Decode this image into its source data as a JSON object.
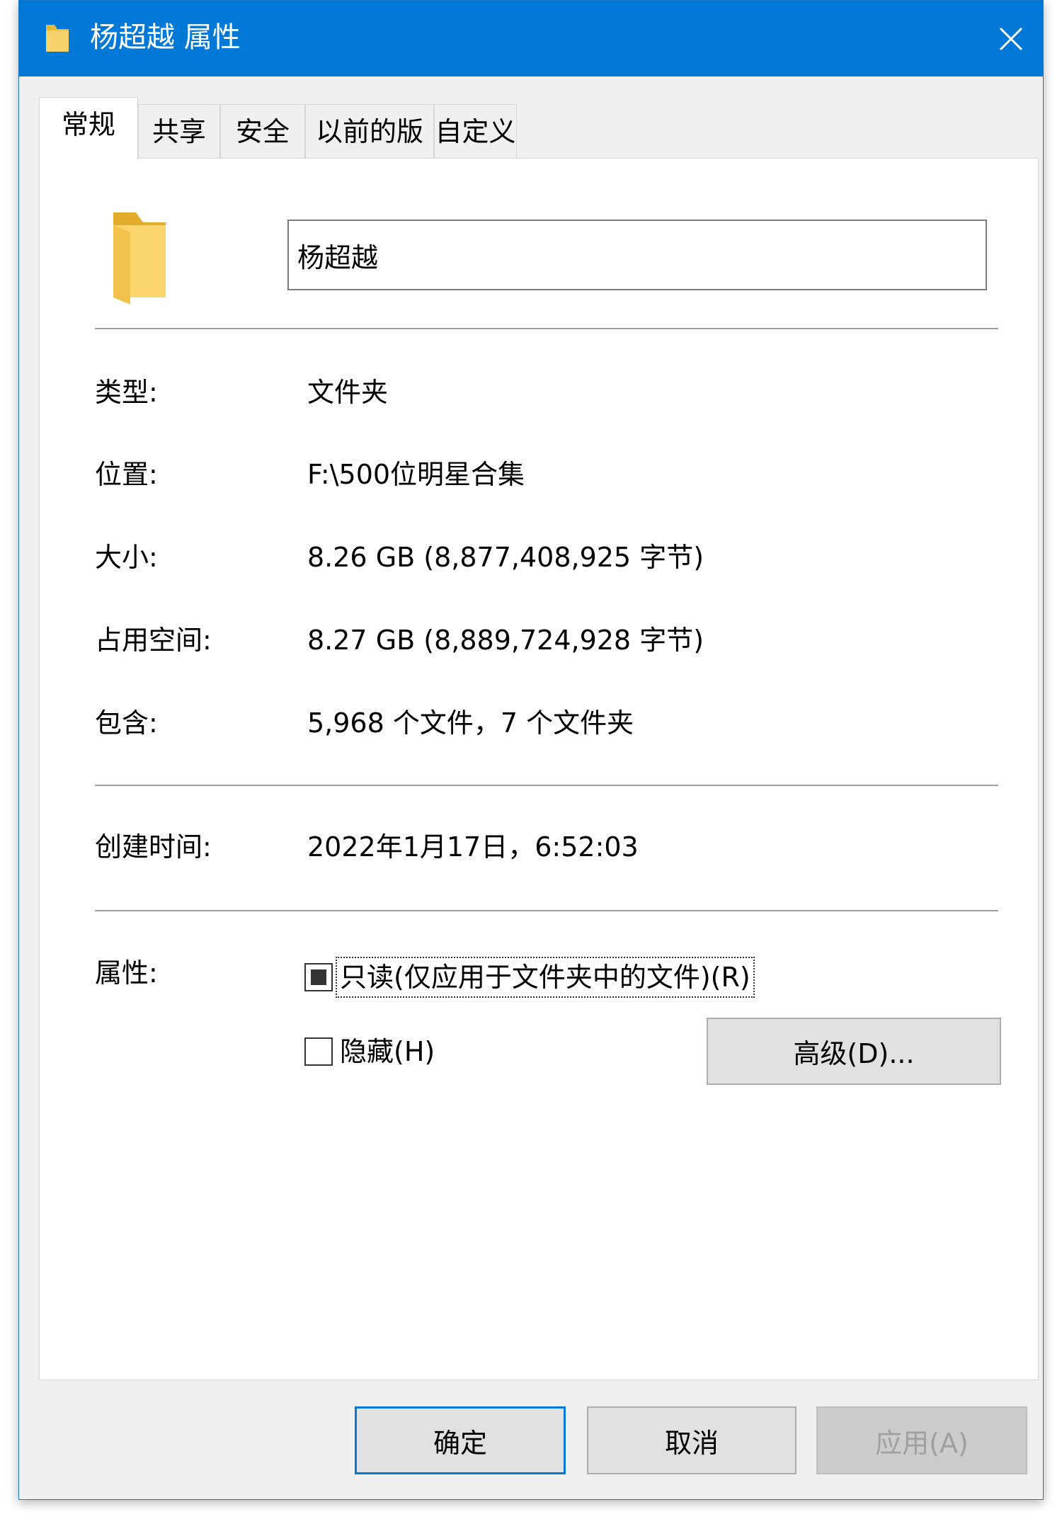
{
  "window": {
    "title": "杨超越 属性",
    "close_glyph": "✕",
    "accent_color": "#0078d7"
  },
  "tabs": [
    {
      "label": "常规",
      "active": true
    },
    {
      "label": "共享",
      "active": false
    },
    {
      "label": "安全",
      "active": false
    },
    {
      "label": "以前的版本",
      "active": false
    },
    {
      "label": "自定义",
      "active": false
    }
  ],
  "general": {
    "name_value": "杨超越",
    "rows": {
      "type": {
        "label": "类型:",
        "value": "文件夹"
      },
      "location": {
        "label": "位置:",
        "value": "F:\\500位明星合集"
      },
      "size": {
        "label": "大小:",
        "value": "8.26 GB (8,877,408,925 字节)"
      },
      "ondisk": {
        "label": "占用空间:",
        "value": "8.27 GB (8,889,724,928 字节)"
      },
      "contains": {
        "label": "包含:",
        "value": "5,968 个文件，7 个文件夹"
      },
      "created": {
        "label": "创建时间:",
        "value": "2022年1月17日，6:52:03"
      }
    },
    "attributes": {
      "label": "属性:",
      "readonly": {
        "label": "只读(仅应用于文件夹中的文件)(R)",
        "state": "indeterminate"
      },
      "hidden": {
        "label": "隐藏(H)",
        "state": "unchecked"
      },
      "advanced_label": "高级(D)..."
    }
  },
  "footer": {
    "ok_label": "确定",
    "cancel_label": "取消",
    "apply_label": "应用(A)"
  }
}
